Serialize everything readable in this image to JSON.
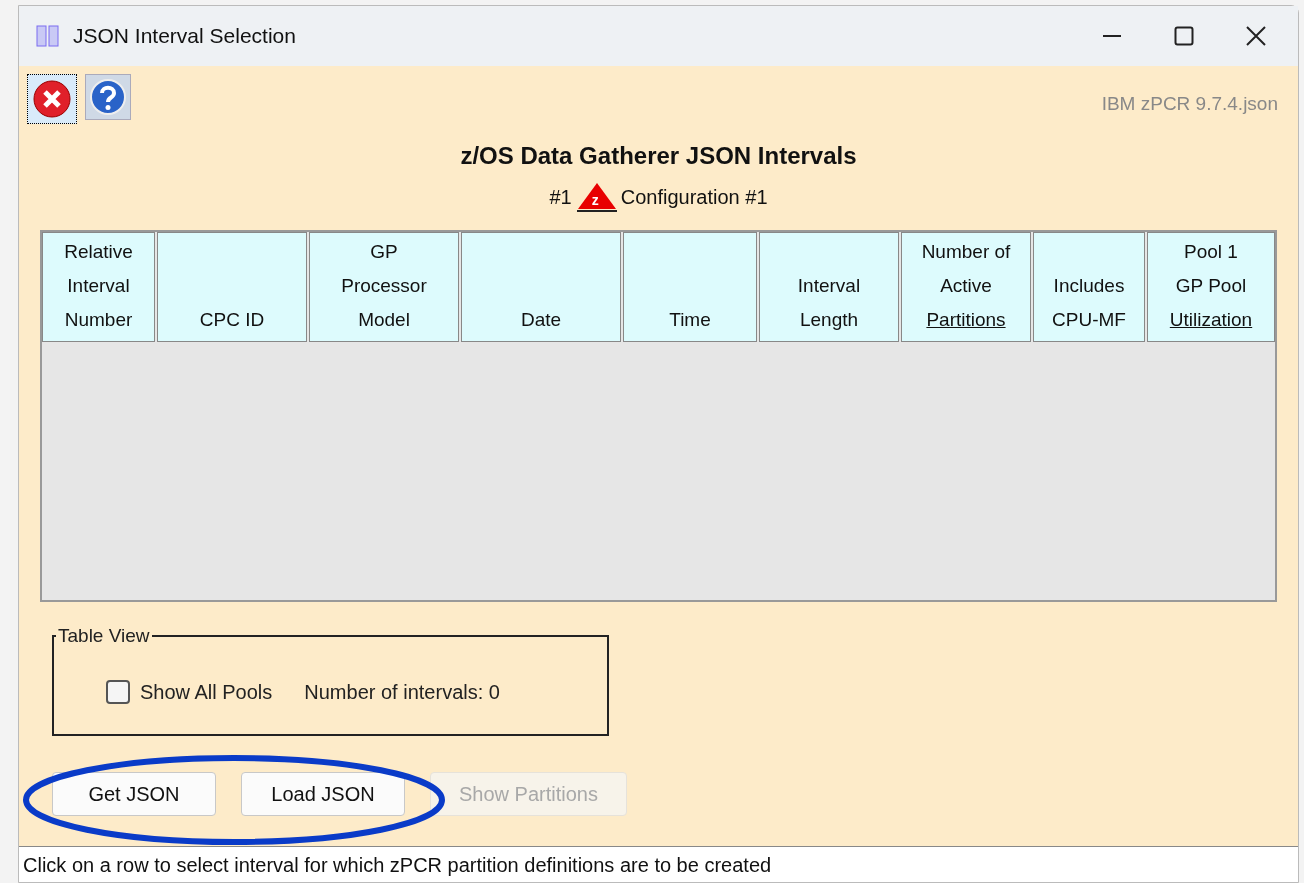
{
  "window": {
    "title": "JSON Interval Selection"
  },
  "toolbar": {
    "file_name": "IBM zPCR 9.7.4.json"
  },
  "heading": {
    "title": "z/OS Data Gatherer JSON Intervals",
    "config_number": "#1",
    "config_badge": "z",
    "config_label": "Configuration #1"
  },
  "table": {
    "columns": [
      {
        "lines": [
          {
            "text": "Relative",
            "underlined": false
          },
          {
            "text": "Interval",
            "underlined": false
          },
          {
            "text": "Number",
            "underlined": false
          }
        ]
      },
      {
        "lines": [
          {
            "text": "CPC ID",
            "underlined": false
          }
        ]
      },
      {
        "lines": [
          {
            "text": "GP",
            "underlined": false
          },
          {
            "text": "Processor",
            "underlined": false
          },
          {
            "text": "Model",
            "underlined": false
          }
        ]
      },
      {
        "lines": [
          {
            "text": "Date",
            "underlined": false
          }
        ]
      },
      {
        "lines": [
          {
            "text": "Time",
            "underlined": false
          }
        ]
      },
      {
        "lines": [
          {
            "text": "Interval",
            "underlined": false
          },
          {
            "text": "Length",
            "underlined": false
          }
        ]
      },
      {
        "lines": [
          {
            "text": "Number of",
            "underlined": false
          },
          {
            "text": "Active",
            "underlined": false
          },
          {
            "text": "Partitions",
            "underlined": true
          }
        ]
      },
      {
        "lines": [
          {
            "text": "Includes",
            "underlined": false
          },
          {
            "text": "CPU-MF",
            "underlined": false
          }
        ]
      },
      {
        "lines": [
          {
            "text": "Pool 1",
            "underlined": false
          },
          {
            "text": "GP Pool",
            "underlined": false
          },
          {
            "text": "Utilization",
            "underlined": true
          }
        ]
      }
    ]
  },
  "table_view": {
    "legend": "Table View",
    "show_all_pools": {
      "label": "Show All Pools",
      "checked": false
    },
    "interval_count": "Number of intervals: 0"
  },
  "buttons": [
    {
      "label": "Get JSON",
      "disabled": false
    },
    {
      "label": "Load JSON",
      "disabled": false
    },
    {
      "label": "Show Partitions",
      "disabled": true
    }
  ],
  "status_bar": "Click on a row to select interval for which zPCR partition definitions are to be created"
}
